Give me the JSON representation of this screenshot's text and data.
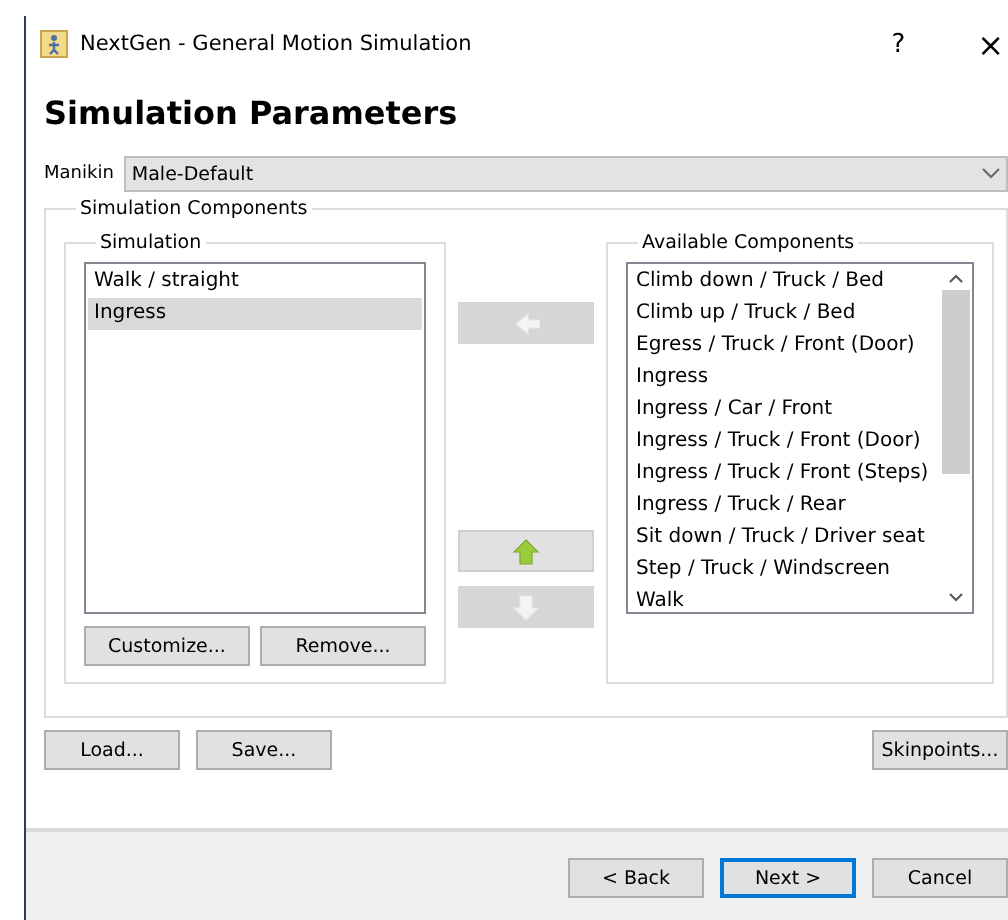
{
  "window": {
    "title": "NextGen - General Motion Simulation",
    "help": "?",
    "close": "×"
  },
  "heading": "Simulation Parameters",
  "manikin": {
    "label": "Manikin",
    "value": "Male-Default"
  },
  "components_group": {
    "title": "Simulation Components"
  },
  "simulation": {
    "title": "Simulation",
    "items": [
      {
        "label": "Walk / straight",
        "selected": false
      },
      {
        "label": "Ingress",
        "selected": true
      }
    ],
    "buttons": [
      "Customize...",
      "Remove..."
    ]
  },
  "move_buttons": [
    {
      "kind": "left",
      "disabled": true
    },
    {
      "kind": "up",
      "disabled": false
    },
    {
      "kind": "down",
      "disabled": true
    }
  ],
  "available": {
    "title": "Available Components",
    "items": [
      {
        "label": "Climb down / Truck / Bed",
        "selected": false
      },
      {
        "label": "Climb up / Truck / Bed",
        "selected": false
      },
      {
        "label": "Egress / Truck / Front (Door)",
        "selected": false
      },
      {
        "label": "Ingress",
        "selected": false
      },
      {
        "label": "Ingress / Car / Front",
        "selected": false
      },
      {
        "label": "Ingress / Truck / Front (Door)",
        "selected": false
      },
      {
        "label": "Ingress / Truck / Front (Steps)",
        "selected": false
      },
      {
        "label": "Ingress / Truck / Rear",
        "selected": false
      },
      {
        "label": "Sit down / Truck / Driver seat",
        "selected": false
      },
      {
        "label": "Step / Truck / Windscreen",
        "selected": false
      },
      {
        "label": "Walk",
        "selected": false
      }
    ]
  },
  "file_buttons": [
    "Load...",
    "Save..."
  ],
  "skinpoints_button": "Skinpoints...",
  "nav_buttons": [
    {
      "label": "< Back",
      "default": false
    },
    {
      "label": "Next >",
      "default": true
    },
    {
      "label": "Cancel",
      "default": false
    }
  ]
}
